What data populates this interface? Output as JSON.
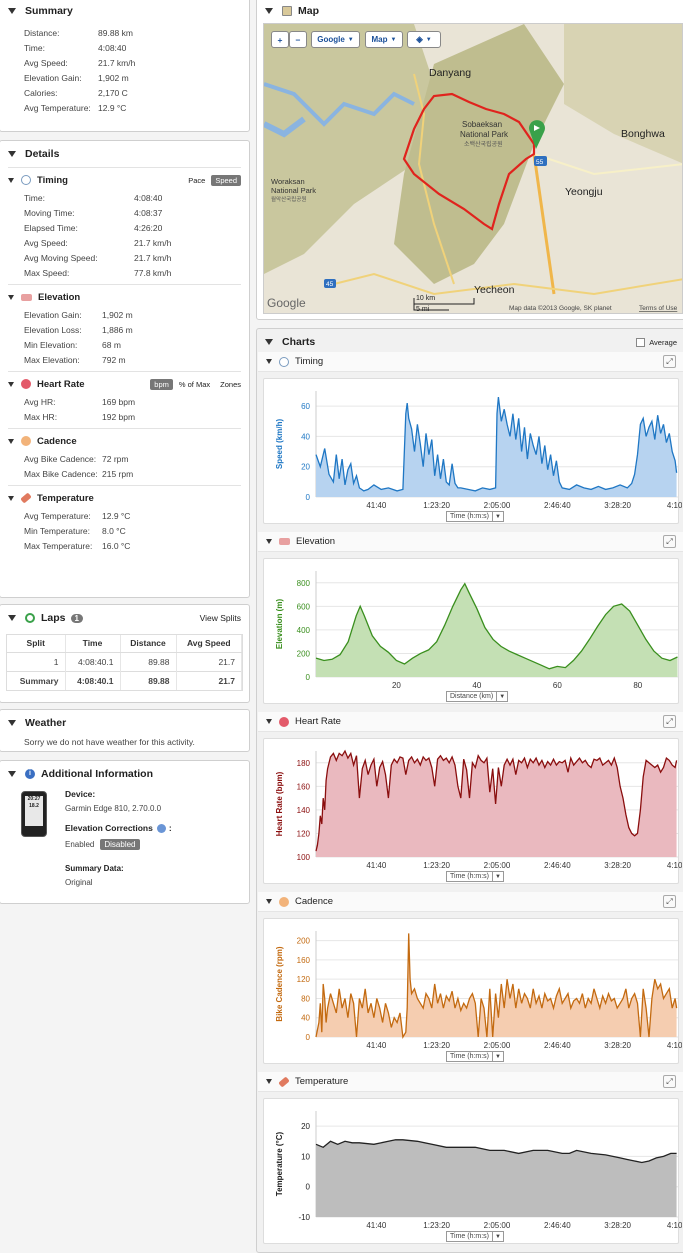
{
  "summary": {
    "title": "Summary",
    "rows": [
      {
        "label": "Distance:",
        "value": "89.88 km"
      },
      {
        "label": "Time:",
        "value": "4:08:40"
      },
      {
        "label": "Avg Speed:",
        "value": "21.7 km/h"
      },
      {
        "label": "Elevation Gain:",
        "value": "1,902 m"
      },
      {
        "label": "Calories:",
        "value": "2,170 C"
      },
      {
        "label": "Avg Temperature:",
        "value": "12.9 °C"
      }
    ]
  },
  "details": {
    "title": "Details",
    "timing": {
      "title": "Timing",
      "pace": "Pace",
      "speed": "Speed",
      "rows": [
        {
          "label": "Time:",
          "value": "4:08:40"
        },
        {
          "label": "Moving Time:",
          "value": "4:08:37"
        },
        {
          "label": "Elapsed Time:",
          "value": "4:26:20"
        },
        {
          "label": "Avg Speed:",
          "value": "21.7 km/h"
        },
        {
          "label": "Avg Moving Speed:",
          "value": "21.7 km/h"
        },
        {
          "label": "Max Speed:",
          "value": "77.8 km/h"
        }
      ]
    },
    "elevation": {
      "title": "Elevation",
      "rows": [
        {
          "label": "Elevation Gain:",
          "value": "1,902 m"
        },
        {
          "label": "Elevation Loss:",
          "value": "1,886 m"
        },
        {
          "label": "Min Elevation:",
          "value": "68 m"
        },
        {
          "label": "Max Elevation:",
          "value": "792 m"
        }
      ]
    },
    "heartrate": {
      "title": "Heart Rate",
      "bpm": "bpm",
      "pct": "% of Max",
      "zones": "Zones",
      "rows": [
        {
          "label": "Avg HR:",
          "value": "169 bpm"
        },
        {
          "label": "Max HR:",
          "value": "192 bpm"
        }
      ]
    },
    "cadence": {
      "title": "Cadence",
      "rows": [
        {
          "label": "Avg Bike Cadence:",
          "value": "72 rpm"
        },
        {
          "label": "Max Bike Cadence:",
          "value": "215 rpm"
        }
      ]
    },
    "temperature": {
      "title": "Temperature",
      "rows": [
        {
          "label": "Avg Temperature:",
          "value": "12.9 °C"
        },
        {
          "label": "Min Temperature:",
          "value": "8.0 °C"
        },
        {
          "label": "Max Temperature:",
          "value": "16.0 °C"
        }
      ]
    }
  },
  "laps": {
    "title": "Laps",
    "count": "1",
    "view_splits": "View Splits",
    "columns": [
      "Split",
      "Time",
      "Distance",
      "Avg Speed"
    ],
    "rows": [
      [
        "1",
        "4:08:40.1",
        "89.88",
        "21.7"
      ],
      [
        "Summary",
        "4:08:40.1",
        "89.88",
        "21.7"
      ]
    ]
  },
  "weather": {
    "title": "Weather",
    "text": "Sorry we do not have weather for this activity."
  },
  "additional": {
    "title": "Additional Information",
    "device_label": "Device:",
    "device": "Garmin Edge 810, 2.70.0.0",
    "elev_corr": "Elevation Corrections",
    "enabled": "Enabled",
    "disabled": "Disabled",
    "summary_label": "Summary Data:",
    "summary_value": "Original",
    "watch_time": "20:27",
    "watch_val": "18.2"
  },
  "map": {
    "title": "Map",
    "google": "Google",
    "map_type": "Map",
    "plus": "+",
    "minus": "−",
    "places": [
      "Danyang",
      "Sobaeksan",
      "National Park",
      "소백산국립공원",
      "Bonghwa",
      "Yeongju",
      "Woraksan",
      "National Park",
      "월악산국립공원",
      "Yecheon",
      "55",
      "45"
    ],
    "scale_km": "10 km",
    "scale_mi": "5 mi",
    "attribution": "Map data ©2013 Google, SK planet",
    "terms": "Terms of Use",
    "logo": "Google"
  },
  "charts": {
    "title": "Charts",
    "average": "Average",
    "time_selector": "Time (h:m:s)",
    "distance_selector": "Distance (km)",
    "time_ticks": [
      "41:40",
      "1:23:20",
      "2:05:00",
      "2:46:40",
      "3:28:20",
      "4:10:0"
    ],
    "distance_ticks": [
      "20",
      "40",
      "60",
      "80"
    ]
  },
  "chart_data": [
    {
      "type": "area",
      "title": "Timing",
      "ylabel": "Speed (km/h)",
      "xlabel": "Time (h:m:s)",
      "ylim": [
        0,
        70
      ],
      "yticks": [
        0,
        20,
        40,
        60
      ],
      "color": "#1f77c4",
      "x": [
        0,
        3,
        6,
        9,
        12,
        14,
        16,
        18,
        20,
        22,
        24,
        26,
        28,
        30,
        33,
        36,
        40,
        45,
        50,
        56,
        60,
        62,
        63,
        64,
        66,
        68,
        70,
        72,
        74,
        76,
        78,
        80,
        82,
        84,
        86,
        88,
        90,
        92,
        94,
        96,
        98,
        100,
        105,
        110,
        115,
        120,
        124,
        125,
        126,
        128,
        130,
        132,
        134,
        136,
        138,
        140,
        142,
        144,
        146,
        148,
        150,
        152,
        154,
        156,
        158,
        160,
        162,
        164,
        166,
        168,
        170,
        175,
        180,
        185,
        190,
        195,
        200,
        205,
        210,
        215,
        218,
        220,
        222,
        224,
        226,
        228,
        230,
        232,
        234,
        236,
        238,
        240,
        242,
        244,
        246,
        248,
        249
      ],
      "values": [
        28,
        20,
        32,
        15,
        10,
        28,
        12,
        25,
        8,
        18,
        22,
        9,
        14,
        6,
        4,
        5,
        8,
        5,
        6,
        4,
        5,
        55,
        62,
        52,
        45,
        30,
        48,
        35,
        20,
        42,
        28,
        38,
        14,
        28,
        12,
        25,
        10,
        8,
        22,
        9,
        6,
        6,
        5,
        4,
        6,
        5,
        6,
        55,
        66,
        50,
        58,
        48,
        40,
        55,
        38,
        52,
        30,
        46,
        25,
        42,
        34,
        28,
        40,
        22,
        34,
        18,
        28,
        14,
        24,
        10,
        6,
        5,
        8,
        6,
        5,
        7,
        5,
        6,
        8,
        6,
        9,
        15,
        28,
        48,
        52,
        40,
        46,
        50,
        38,
        54,
        42,
        48,
        36,
        42,
        30,
        24,
        16
      ]
    },
    {
      "type": "area",
      "title": "Elevation",
      "ylabel": "Elevation (m)",
      "xlabel": "Distance (km)",
      "ylim": [
        0,
        900
      ],
      "yticks": [
        0,
        200,
        400,
        600,
        800
      ],
      "color": "#3a8f1e",
      "x": [
        0,
        2,
        4,
        6,
        8,
        10,
        11,
        12,
        14,
        16,
        18,
        20,
        22,
        24,
        26,
        28,
        30,
        32,
        34,
        36,
        37,
        38,
        40,
        42,
        44,
        46,
        48,
        50,
        52,
        54,
        56,
        58,
        60,
        62,
        64,
        66,
        68,
        70,
        72,
        74,
        76,
        78,
        80,
        82,
        84,
        86,
        88,
        89.88
      ],
      "values": [
        160,
        140,
        150,
        190,
        300,
        520,
        600,
        520,
        350,
        260,
        210,
        140,
        110,
        160,
        200,
        230,
        300,
        440,
        600,
        740,
        792,
        720,
        580,
        420,
        320,
        260,
        220,
        190,
        160,
        130,
        100,
        70,
        90,
        80,
        140,
        220,
        320,
        430,
        530,
        600,
        620,
        560,
        440,
        320,
        220,
        160,
        140,
        170
      ]
    },
    {
      "type": "area",
      "title": "Heart Rate",
      "ylabel": "Heart Rate (bpm)",
      "xlabel": "Time (h:m:s)",
      "ylim": [
        100,
        190
      ],
      "yticks": [
        100,
        120,
        140,
        160,
        180
      ],
      "color": "#8a0e0e",
      "x": [
        0,
        1,
        2,
        3,
        4,
        5,
        6,
        7,
        8,
        10,
        12,
        14,
        16,
        18,
        20,
        22,
        24,
        26,
        28,
        30,
        32,
        34,
        36,
        38,
        40,
        42,
        44,
        46,
        48,
        50,
        52,
        54,
        56,
        58,
        60,
        62,
        64,
        66,
        68,
        70,
        72,
        74,
        76,
        78,
        80,
        82,
        84,
        86,
        88,
        90,
        92,
        94,
        96,
        98,
        100,
        102,
        104,
        106,
        108,
        110,
        112,
        114,
        116,
        118,
        120,
        122,
        124,
        126,
        128,
        130,
        132,
        134,
        136,
        138,
        140,
        142,
        144,
        146,
        148,
        150,
        152,
        154,
        156,
        158,
        160,
        162,
        164,
        166,
        168,
        170,
        172,
        174,
        176,
        178,
        180,
        182,
        184,
        186,
        188,
        190,
        192,
        194,
        196,
        198,
        200,
        202,
        204,
        206,
        208,
        210,
        212,
        214,
        216,
        218,
        220,
        222,
        224,
        226,
        228,
        230,
        232,
        234,
        236,
        238,
        240,
        242,
        244,
        246,
        248,
        249
      ],
      "values": [
        105,
        110,
        120,
        135,
        128,
        150,
        140,
        165,
        175,
        185,
        188,
        182,
        188,
        186,
        190,
        184,
        188,
        178,
        186,
        150,
        175,
        182,
        170,
        178,
        183,
        160,
        176,
        181,
        170,
        150,
        178,
        183,
        180,
        185,
        184,
        170,
        182,
        185,
        180,
        183,
        178,
        185,
        182,
        184,
        176,
        160,
        183,
        186,
        182,
        184,
        180,
        185,
        178,
        160,
        150,
        183,
        174,
        150,
        180,
        176,
        186,
        182,
        180,
        184,
        155,
        175,
        145,
        176,
        160,
        178,
        183,
        178,
        183,
        170,
        182,
        180,
        184,
        176,
        183,
        180,
        184,
        178,
        182,
        176,
        181,
        178,
        183,
        178,
        181,
        180,
        182,
        172,
        184,
        178,
        181,
        184,
        180,
        182,
        178,
        176,
        183,
        182,
        184,
        178,
        180,
        182,
        178,
        184,
        176,
        160,
        150,
        136,
        125,
        120,
        118,
        120,
        140,
        168,
        182,
        180,
        178,
        176,
        178,
        172,
        176,
        184,
        182,
        178,
        176,
        182
      ]
    },
    {
      "type": "area",
      "title": "Cadence",
      "ylabel": "Bike Cadence (rpm)",
      "xlabel": "Time (h:m:s)",
      "ylim": [
        0,
        220
      ],
      "yticks": [
        0,
        40,
        80,
        120,
        160,
        200
      ],
      "color": "#c36a10",
      "x": [
        0,
        2,
        3,
        4,
        5,
        6,
        7,
        8,
        10,
        12,
        14,
        16,
        18,
        20,
        22,
        24,
        26,
        28,
        30,
        32,
        34,
        36,
        38,
        40,
        42,
        44,
        46,
        48,
        50,
        52,
        54,
        56,
        58,
        60,
        62,
        63,
        64,
        65,
        66,
        68,
        70,
        72,
        74,
        76,
        78,
        80,
        82,
        84,
        86,
        88,
        90,
        92,
        94,
        96,
        98,
        100,
        102,
        104,
        106,
        108,
        110,
        112,
        114,
        116,
        118,
        120,
        122,
        124,
        126,
        128,
        130,
        132,
        134,
        136,
        138,
        140,
        142,
        144,
        146,
        148,
        150,
        152,
        154,
        156,
        158,
        160,
        162,
        164,
        166,
        168,
        170,
        172,
        174,
        176,
        178,
        180,
        182,
        184,
        186,
        188,
        190,
        192,
        194,
        196,
        198,
        200,
        202,
        204,
        206,
        208,
        210,
        212,
        214,
        216,
        218,
        220,
        222,
        224,
        226,
        228,
        230,
        232,
        234,
        236,
        238,
        240,
        242,
        244,
        246,
        248,
        249
      ],
      "values": [
        0,
        30,
        70,
        10,
        110,
        80,
        30,
        60,
        90,
        70,
        50,
        100,
        60,
        80,
        40,
        90,
        70,
        0,
        80,
        60,
        100,
        50,
        70,
        40,
        80,
        60,
        30,
        70,
        50,
        20,
        40,
        30,
        50,
        0,
        10,
        60,
        215,
        120,
        90,
        100,
        80,
        70,
        60,
        90,
        80,
        60,
        110,
        70,
        90,
        60,
        85,
        75,
        95,
        60,
        80,
        55,
        70,
        60,
        80,
        90,
        70,
        0,
        80,
        60,
        0,
        100,
        0,
        90,
        40,
        110,
        60,
        120,
        80,
        110,
        60,
        100,
        70,
        90,
        80,
        60,
        100,
        70,
        85,
        60,
        90,
        75,
        80,
        60,
        85,
        100,
        70,
        80,
        90,
        60,
        75,
        80,
        70,
        90,
        60,
        80,
        70,
        100,
        80,
        60,
        85,
        70,
        90,
        75,
        80,
        60,
        70,
        80,
        100,
        60,
        80,
        90,
        70,
        0,
        100,
        60,
        0,
        80,
        120,
        100,
        110,
        80,
        90,
        100,
        60,
        80,
        60
      ]
    },
    {
      "type": "area",
      "title": "Temperature",
      "ylabel": "Temperature (°C)",
      "xlabel": "Time (h:m:s)",
      "ylim": [
        -10,
        25
      ],
      "yticks": [
        -10,
        0,
        10,
        20
      ],
      "color": "#222222",
      "x": [
        0,
        5,
        10,
        15,
        20,
        25,
        30,
        40,
        50,
        55,
        60,
        70,
        80,
        90,
        100,
        110,
        120,
        125,
        130,
        140,
        150,
        160,
        170,
        175,
        180,
        190,
        200,
        210,
        215,
        220,
        225,
        230,
        235,
        240,
        245,
        249
      ],
      "values": [
        14,
        13,
        15,
        14,
        15,
        14.5,
        14.5,
        14,
        15,
        15.5,
        15.5,
        15,
        14,
        13,
        13,
        13,
        12,
        12,
        12,
        11,
        12,
        12,
        11,
        11,
        12,
        11,
        10.5,
        9.5,
        9,
        8.5,
        8,
        8.5,
        9.5,
        10,
        11,
        11
      ]
    }
  ]
}
